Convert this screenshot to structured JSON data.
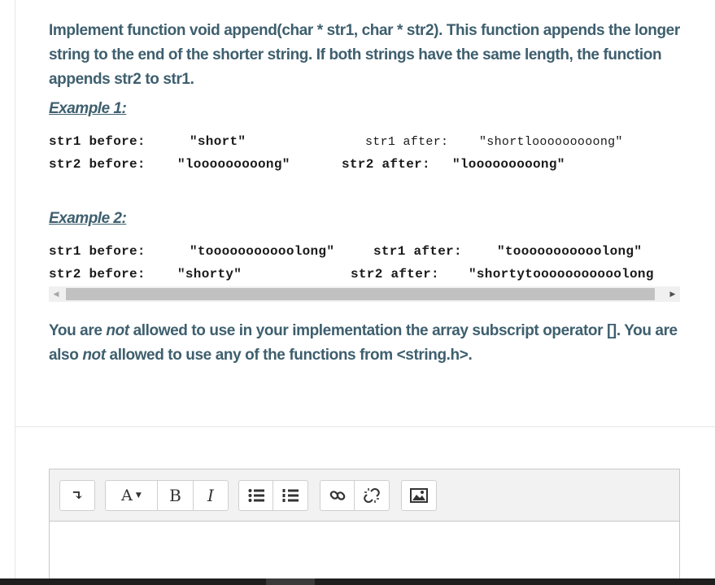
{
  "question": {
    "text": "Implement function void append(char * str1, char * str2). This function appends the longer string to the end of the shorter string. If both strings have the same length, the function appends str2 to str1."
  },
  "examples": [
    {
      "heading": "Example 1:",
      "str1_before_label": "str1 before:",
      "str1_before_value": "\"short\"",
      "str1_after_label": "str1 after:",
      "str1_after_value": "\"shortlooooooooong\"",
      "str2_before_label": "str2 before:",
      "str2_before_value": "\"looooooooong\"",
      "str2_after_label": "str2 after:",
      "str2_after_value": "\"looooooooong\""
    },
    {
      "heading": "Example 2:",
      "str1_before_label": "str1 before:",
      "str1_before_value": "\"tooooooooooolong\"",
      "str1_after_label": "str1 after:",
      "str1_after_value": "\"tooooooooooolong\"",
      "str2_before_label": "str2 before:",
      "str2_before_value": "\"shorty\"",
      "str2_after_label": "str2 after:",
      "str2_after_value": "\"shortytooooooooooolong"
    }
  ],
  "note": {
    "part1": "You are ",
    "not1": "not",
    "part2": " allowed to use in your implementation the array subscript operator []. You are also ",
    "not2": "not",
    "part3": " allowed to use any of the functions from <string.h>."
  },
  "toolbar": {
    "collapse_glyph": "↴",
    "font_glyph": "A",
    "bold_glyph": "B",
    "italic_glyph": "I"
  },
  "colors": {
    "text": "#3e5f6e",
    "toolbar_bg": "#f2f2f2"
  }
}
